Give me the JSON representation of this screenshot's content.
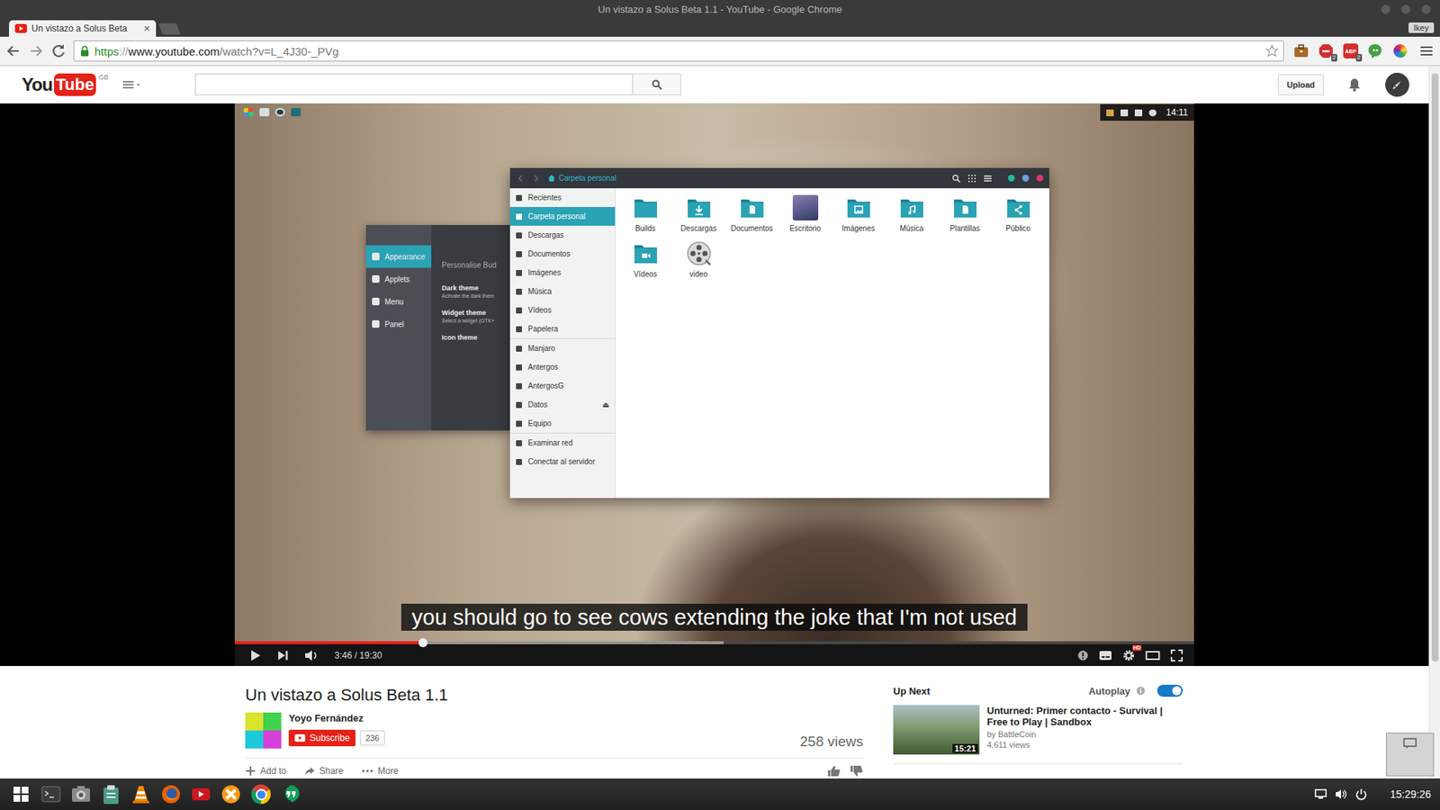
{
  "window": {
    "title": "Un vistazo a Solus Beta 1.1 - YouTube - Google Chrome",
    "profile": "Ikey"
  },
  "tabs": [
    {
      "label": "Un vistazo a Solus Beta",
      "close": "×",
      "selected": true
    }
  ],
  "address_bar": {
    "scheme": "https",
    "separator": "://",
    "host": "www.youtube.com",
    "path": "/watch?v=L_4J30-_PVg",
    "secure": true,
    "bookmarked": false
  },
  "extensions": [
    {
      "kind": "briefcase",
      "color": "#a8692b"
    },
    {
      "kind": "stop",
      "badge": "2",
      "color": "#d32f2f"
    },
    {
      "kind": "abp",
      "glyph": "ABP",
      "badge": "2",
      "color": "#d32f2f"
    },
    {
      "kind": "bubble",
      "color": "#43a047"
    },
    {
      "kind": "wheel",
      "color": "#8e24aa"
    }
  ],
  "youtube_header": {
    "logo_you": "You",
    "logo_tube": "Tube",
    "region": "GB",
    "upload": "Upload"
  },
  "player": {
    "paused": true,
    "played": 0.196,
    "buffered": 0.51,
    "time": "3:46 / 19:30",
    "hd_badge": "HD",
    "caption": "you should go to see cows extending the joke that I'm not used"
  },
  "video_screen": {
    "panel": {
      "launchers": [
        {
          "kind": "menu"
        },
        {
          "kind": "window"
        },
        {
          "kind": "settings"
        },
        {
          "kind": "screen"
        }
      ],
      "tray": [
        {
          "kind": "network"
        },
        {
          "kind": "display"
        },
        {
          "kind": "volume"
        },
        {
          "kind": "power"
        }
      ],
      "clock": "14:11"
    },
    "settings_window": {
      "nav": [
        {
          "label": "Appearance",
          "selected": true
        },
        {
          "label": "Applets",
          "selected": false
        },
        {
          "label": "Menu",
          "selected": false
        },
        {
          "label": "Panel",
          "selected": false
        }
      ],
      "heading": "Personalise Bud",
      "options": [
        {
          "title": "Dark theme",
          "hint": "Activate the dark them"
        },
        {
          "title": "Widget theme",
          "hint": "Select a widget (GTK+"
        },
        {
          "title": "Icon theme"
        }
      ]
    },
    "file_manager": {
      "location": "Carpeta personal",
      "controls": [
        {
          "color": "#2bb5a3"
        },
        {
          "color": "#6b9ee0"
        },
        {
          "color": "#d9386a"
        }
      ],
      "sidebar": [
        [
          {
            "label": "Recientes",
            "selected": false
          },
          {
            "label": "Carpeta personal",
            "selected": true
          },
          {
            "label": "Descargas",
            "selected": false
          },
          {
            "label": "Documentos",
            "selected": false
          },
          {
            "label": "Imágenes",
            "selected": false
          },
          {
            "label": "Música",
            "selected": false
          },
          {
            "label": "Vídeos",
            "selected": false
          },
          {
            "label": "Papelera",
            "selected": false
          }
        ],
        [
          {
            "label": "Manjaro",
            "selected": false
          },
          {
            "label": "Antergos",
            "selected": false
          },
          {
            "label": "AntergosG",
            "selected": false
          },
          {
            "label": "Datos",
            "selected": false,
            "eject": "⏏"
          },
          {
            "label": "Equipo",
            "selected": false
          }
        ],
        [
          {
            "label": "Examinar red",
            "selected": false
          },
          {
            "label": "Conectar al servidor",
            "selected": false
          }
        ]
      ],
      "items": [
        {
          "label": "Builds",
          "kind": "folder"
        },
        {
          "label": "Descargas",
          "kind": "downloads"
        },
        {
          "label": "Documentos",
          "kind": "documents"
        },
        {
          "label": "Escritorio",
          "kind": "desktop"
        },
        {
          "label": "Imágenes",
          "kind": "pictures"
        },
        {
          "label": "Música",
          "kind": "music"
        },
        {
          "label": "Plantillas",
          "kind": "templates"
        },
        {
          "label": "Público",
          "kind": "public"
        },
        {
          "label": "Vídeos",
          "kind": "videos"
        },
        {
          "label": "video",
          "kind": "video-file"
        }
      ]
    }
  },
  "video_info": {
    "title": "Un vistazo a Solus Beta 1.1",
    "channel": "Yoyo Fernández",
    "subscribe": "Subscribe",
    "subscribers": "236",
    "views": "258 views",
    "actions": [
      {
        "label": "Add to",
        "kind": "add"
      },
      {
        "label": "Share",
        "kind": "share"
      },
      {
        "label": "More",
        "kind": "more"
      }
    ]
  },
  "up_next": {
    "heading": "Up Next",
    "autoplay_label": "Autoplay",
    "autoplay": true,
    "videos": [
      {
        "title": "Unturned: Primer contacto - Survival | Free to Play | Sandbox",
        "channel": "by BattleCoin",
        "views": "4,611 views",
        "duration": "15:21"
      }
    ]
  },
  "taskbar": {
    "apps": [
      {
        "kind": "menu"
      },
      {
        "kind": "terminal"
      },
      {
        "kind": "screenshot"
      },
      {
        "kind": "clipboard"
      },
      {
        "kind": "vlc"
      },
      {
        "kind": "firefox"
      },
      {
        "kind": "youtube"
      },
      {
        "kind": "crossover"
      },
      {
        "kind": "chrome"
      },
      {
        "kind": "hangouts"
      }
    ],
    "tray": [
      {
        "kind": "display"
      },
      {
        "kind": "volume"
      },
      {
        "kind": "power"
      }
    ],
    "clock": "15:29:26"
  }
}
